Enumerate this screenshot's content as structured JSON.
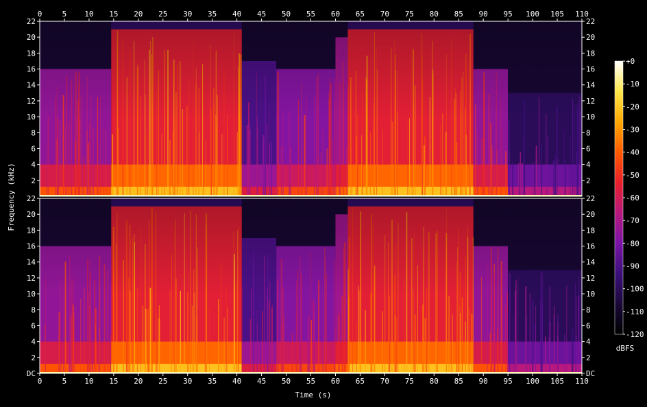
{
  "chart_data": {
    "type": "heatmap",
    "subtype": "spectrogram",
    "channels": 2,
    "xlabel": "Time (s)",
    "ylabel": "Frequency (kHz)",
    "xlim": [
      0,
      110
    ],
    "ylim": [
      0,
      22
    ],
    "x_ticks": [
      0,
      5,
      10,
      15,
      20,
      25,
      30,
      35,
      40,
      45,
      50,
      55,
      60,
      65,
      70,
      75,
      80,
      85,
      90,
      95,
      100,
      105,
      110
    ],
    "y_tick_labels_top": [
      "22",
      "20",
      "18",
      "16",
      "14",
      "12",
      "10",
      "8",
      "6",
      "4",
      "2"
    ],
    "y_tick_labels_bottom": [
      "22",
      "20",
      "18",
      "16",
      "14",
      "12",
      "10",
      "8",
      "6",
      "4",
      "2",
      "DC"
    ],
    "colorbar": {
      "label": "dBFS",
      "range": [
        -120,
        0
      ],
      "ticks": [
        "+0",
        "-10",
        "-20",
        "-30",
        "-40",
        "-50",
        "-60",
        "-70",
        "-80",
        "-90",
        "-100",
        "-110",
        "-120"
      ],
      "colormap": [
        "#000000",
        "#1a0838",
        "#3a0f7a",
        "#7a14a6",
        "#b8187e",
        "#e8202a",
        "#ff5a00",
        "#ffa800",
        "#ffe84a",
        "#ffffff"
      ]
    },
    "segments": [
      {
        "start": 0,
        "end": 14.5,
        "level_db": -75,
        "cutoff_khz": 16
      },
      {
        "start": 14.5,
        "end": 41,
        "level_db": -55,
        "cutoff_khz": 21
      },
      {
        "start": 41,
        "end": 48,
        "level_db": -90,
        "cutoff_khz": 17
      },
      {
        "start": 48,
        "end": 60,
        "level_db": -78,
        "cutoff_khz": 16
      },
      {
        "start": 60,
        "end": 62.5,
        "level_db": -72,
        "cutoff_khz": 20
      },
      {
        "start": 62.5,
        "end": 88,
        "level_db": -55,
        "cutoff_khz": 21
      },
      {
        "start": 88,
        "end": 95,
        "level_db": -75,
        "cutoff_khz": 16
      },
      {
        "start": 95,
        "end": 110,
        "level_db": -100,
        "cutoff_khz": 13
      }
    ]
  }
}
